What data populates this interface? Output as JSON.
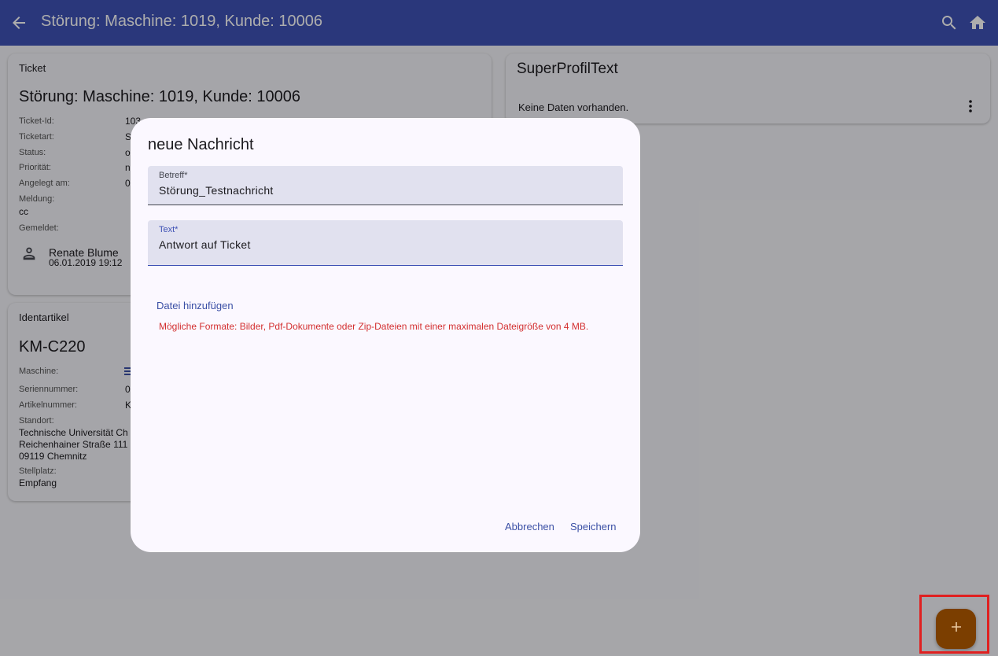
{
  "appbar": {
    "title": "Störung: Maschine: 1019, Kunde: 10006",
    "bg": "#3f51b5",
    "icons": [
      "arrow-back-icon",
      "search-icon",
      "home-icon"
    ]
  },
  "ticket_card": {
    "header": "Ticket",
    "title": "Störung: Maschine: 1019, Kunde: 10006",
    "fields": [
      {
        "label": "Ticket-Id:",
        "value": "103"
      },
      {
        "label": "Ticketart:",
        "value": "S"
      },
      {
        "label": "Status:",
        "value": "o"
      },
      {
        "label": "Priorität:",
        "value": "n"
      },
      {
        "label": "Angelegt am:",
        "value": "0"
      }
    ],
    "meldung_label": "Meldung:",
    "meldung_value": "cc",
    "gemeldet_label": "Gemeldet:",
    "reporter_name": "Renate Blume",
    "reporter_date": "06.01.2019 19:12"
  },
  "ident_card": {
    "header": "Identartikel",
    "title": "KM-C220",
    "fields": [
      {
        "label": "Maschine:",
        "value": ""
      },
      {
        "label": "Seriennummer:",
        "value": "0"
      },
      {
        "label": "Artikelnummer:",
        "value": "K"
      }
    ],
    "standort_label": "Standort:",
    "standort_lines": [
      "Technische Universität Ch",
      "Reichenhainer Straße 111",
      "09119 Chemnitz"
    ],
    "stellplatz_label": "Stellplatz:",
    "stellplatz_value": "Empfang"
  },
  "profile_card": {
    "title": "SuperProfilText",
    "empty_text": "Keine Daten vorhanden."
  },
  "dialog": {
    "title": "neue Nachricht",
    "subject_label": "Betreff*",
    "subject_value": "Störung_Testnachricht",
    "text_label": "Text*",
    "text_value": "Antwort auf Ticket",
    "add_file": "Datei hinzufügen",
    "formats_hint": "Mögliche Formate: Bilder, Pdf-Dokumente oder Zip-Dateien mit einer maximalen Dateigröße von 4 MB.",
    "cancel": "Abbrechen",
    "save": "Speichern"
  },
  "fab": {
    "icon": "add-icon",
    "color": "#7b3e00"
  },
  "colors": {
    "accent": "#3f51b5",
    "error": "#d32f2f",
    "highlight": "#e02020"
  }
}
